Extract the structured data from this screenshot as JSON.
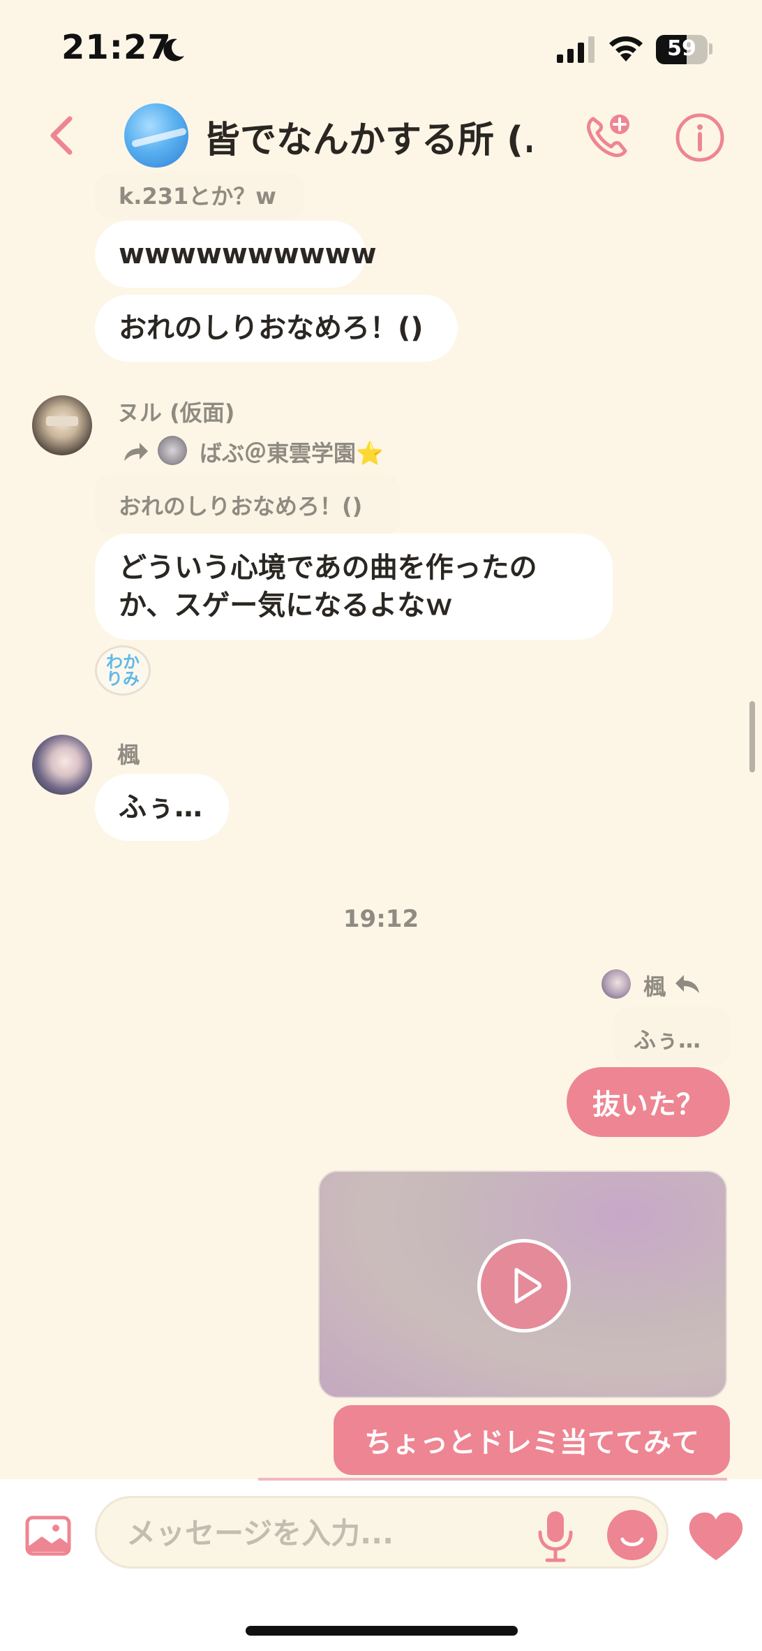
{
  "status_bar": {
    "time": "21:27",
    "battery": "59"
  },
  "header": {
    "title": "皆でなんかする所 (..."
  },
  "messages": {
    "top_quote": "k.231とか？w",
    "msg1": "wwwwwwwwww",
    "msg2": "おれのしりおなめろ！()",
    "nul": {
      "sender": "ヌル (仮面)",
      "reply_to": "ばぶ＠東雲学園⭐️",
      "quote": "おれのしりおなめろ！()",
      "line1": "どういう心境であの曲を作ったの",
      "line2": "か、スゲー気になるよなｗ",
      "reaction_line1": "わか",
      "reaction_line2": "りみ"
    },
    "kaede": {
      "sender": "楓",
      "text": "ふぅ…"
    },
    "timestamp": "19:12",
    "mine": {
      "reply_to": "楓",
      "quote": "ふぅ…",
      "text1": "抜いた？",
      "text2": "ちょっとドレミ当ててみて"
    }
  },
  "input": {
    "placeholder": "メッセージを入力..."
  },
  "colors": {
    "accent": "#ee8592",
    "background": "#fdf6e6"
  },
  "icons": [
    "back-chevron-icon",
    "call-add-icon",
    "info-icon",
    "share-arrow-icon",
    "reply-icon",
    "play-icon",
    "image-icon",
    "microphone-icon",
    "emoji-icon",
    "heart-icon"
  ]
}
